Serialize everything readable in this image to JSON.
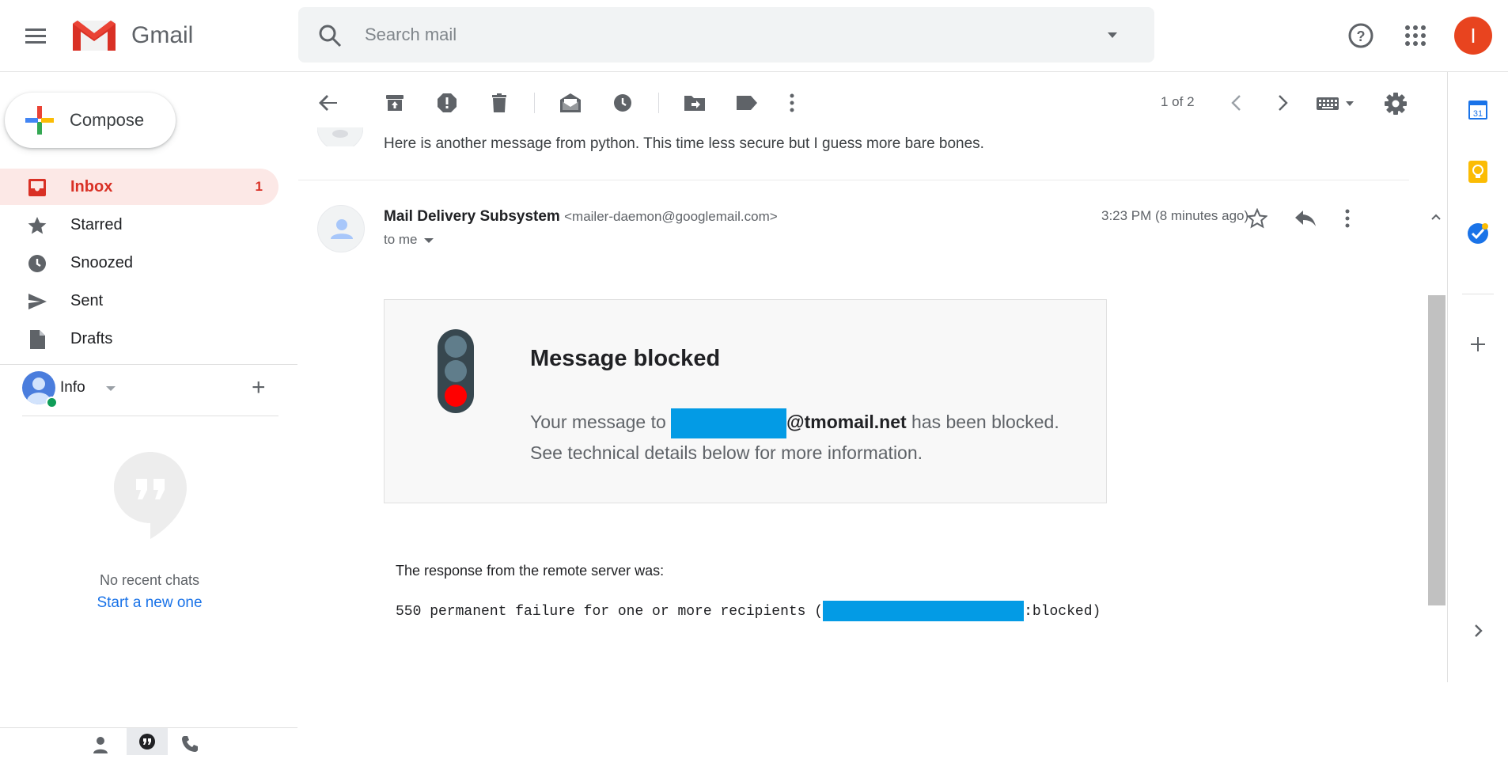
{
  "app": {
    "brand": "Gmail"
  },
  "search": {
    "placeholder": "Search mail"
  },
  "header": {
    "avatar_letter": "I"
  },
  "compose": {
    "label": "Compose"
  },
  "nav": [
    {
      "label": "Inbox",
      "count": "1"
    },
    {
      "label": "Starred",
      "count": ""
    },
    {
      "label": "Snoozed",
      "count": ""
    },
    {
      "label": "Sent",
      "count": ""
    },
    {
      "label": "Drafts",
      "count": ""
    }
  ],
  "hangouts": {
    "user": "Info",
    "empty": "No recent chats",
    "start": "Start a new one"
  },
  "toolbar": {
    "pager": "1 of 2"
  },
  "thread": {
    "previous_snippet": "Here is another message from python. This time less secure but I guess more bare bones.",
    "sender_name": "Mail Delivery Subsystem",
    "sender_addr": "<mailer-daemon@googlemail.com>",
    "to": "to me",
    "time": "3:23 PM (8 minutes ago)"
  },
  "blocked": {
    "title": "Message blocked",
    "text_before": "Your message to ",
    "domain": "@tmomail.net",
    "text_after": " has been blocked.",
    "line2": "See technical details below for more information."
  },
  "response": {
    "intro": "The response from the remote server was:",
    "code_before": "550 permanent failure for one or more recipients (",
    "code_after": ":blocked)"
  },
  "colors": {
    "accent": "#d93025",
    "redaction": "#039be5",
    "link": "#1a73e8"
  }
}
